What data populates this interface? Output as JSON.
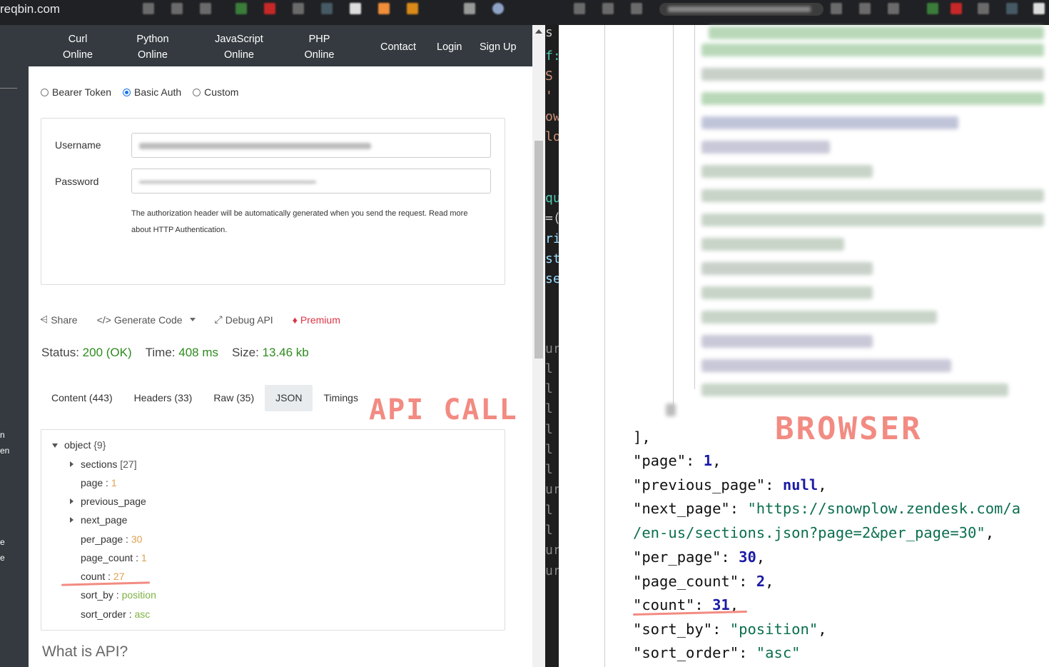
{
  "left_window": {
    "site": "reqbin.com",
    "nav": [
      {
        "line1": "Curl",
        "line2": "Online"
      },
      {
        "line1": "Python",
        "line2": "Online"
      },
      {
        "line1": "JavaScript",
        "line2": "Online"
      },
      {
        "line1": "PHP",
        "line2": "Online"
      },
      {
        "line1": "Contact",
        "line2": ""
      },
      {
        "line1": "Login",
        "line2": ""
      },
      {
        "line1": "Sign Up",
        "line2": ""
      }
    ],
    "sidebar_fragments": [
      "n",
      "en",
      "e",
      "e"
    ],
    "auth_types": [
      "Bearer Token",
      "Basic Auth",
      "Custom"
    ],
    "auth_selected": "Basic Auth",
    "username_label": "Username",
    "password_label": "Password",
    "auth_note": "The authorization header will be automatically generated when you send the request. Read more about HTTP Authentication.",
    "actions": {
      "share": "Share",
      "generate_code": "Generate Code",
      "debug_api": "Debug API",
      "premium": "Premium"
    },
    "status": {
      "status_label": "Status:",
      "status_value": "200 (OK)",
      "time_label": "Time:",
      "time_value": "408 ms",
      "size_label": "Size:",
      "size_value": "13.46 kb"
    },
    "tabs": [
      "Content (443)",
      "Headers (33)",
      "Raw (35)",
      "JSON",
      "Timings"
    ],
    "active_tab": "JSON",
    "overlay_label": "API CALL",
    "json_tree": {
      "root": "object",
      "root_count": "{9}",
      "rows": [
        {
          "key": "sections",
          "meta": "[27]",
          "value": "",
          "type": "expand"
        },
        {
          "key": "page",
          "value": "1",
          "type": "num"
        },
        {
          "key": "previous_page",
          "value": "",
          "type": "expand"
        },
        {
          "key": "next_page",
          "value": "",
          "type": "expand"
        },
        {
          "key": "per_page",
          "value": "30",
          "type": "num"
        },
        {
          "key": "page_count",
          "value": "1",
          "type": "num"
        },
        {
          "key": "count",
          "value": "27",
          "type": "num"
        },
        {
          "key": "sort_by",
          "value": "position",
          "type": "str"
        },
        {
          "key": "sort_order",
          "value": "asc",
          "type": "str"
        }
      ]
    },
    "what_is_api": "What is API?"
  },
  "right_window": {
    "overlay_label": "BROWSER",
    "editor_fragments": [
      "s",
      "f:",
      "S",
      "'",
      "ow",
      "lo",
      "qu",
      "=(",
      "ri",
      "st",
      "se",
      "ur",
      "l",
      "l",
      "l",
      "l",
      "l",
      "l",
      "ur",
      "l",
      "l",
      "ur",
      "ur"
    ],
    "json_lines": [
      {
        "text": "],",
        "parts": [
          {
            "t": "],",
            "c": ""
          }
        ]
      },
      {
        "parts": [
          {
            "t": "\"page\": ",
            "c": ""
          },
          {
            "t": "1",
            "c": "kw"
          },
          {
            "t": ",",
            "c": ""
          }
        ]
      },
      {
        "parts": [
          {
            "t": "\"previous_page\": ",
            "c": ""
          },
          {
            "t": "null",
            "c": "kw"
          },
          {
            "t": ",",
            "c": ""
          }
        ]
      },
      {
        "parts": [
          {
            "t": "\"next_page\": ",
            "c": ""
          },
          {
            "t": "\"https://snowplow.zendesk.com/a",
            "c": "s"
          }
        ]
      },
      {
        "parts": [
          {
            "t": "/en-us/sections.json?page=2&per_page=30\"",
            "c": "s"
          },
          {
            "t": ",",
            "c": ""
          }
        ]
      },
      {
        "parts": [
          {
            "t": "\"per_page\": ",
            "c": ""
          },
          {
            "t": "30",
            "c": "kw"
          },
          {
            "t": ",",
            "c": ""
          }
        ]
      },
      {
        "parts": [
          {
            "t": "\"page_count\": ",
            "c": ""
          },
          {
            "t": "2",
            "c": "kw"
          },
          {
            "t": ",",
            "c": ""
          }
        ]
      },
      {
        "parts": [
          {
            "t": "\"count\": ",
            "c": ""
          },
          {
            "t": "31",
            "c": "kw"
          },
          {
            "t": ",",
            "c": ""
          }
        ]
      },
      {
        "parts": [
          {
            "t": "\"sort_by\": ",
            "c": ""
          },
          {
            "t": "\"position\"",
            "c": "s"
          },
          {
            "t": ",",
            "c": ""
          }
        ]
      },
      {
        "parts": [
          {
            "t": "\"sort_order\": ",
            "c": ""
          },
          {
            "t": "\"asc\"",
            "c": "s"
          }
        ]
      }
    ]
  },
  "colors": {
    "overlay": "#f28b82",
    "status_green": "#2e8b1e",
    "navbar": "#343a40",
    "json_keyword": "#1a1aa6",
    "json_string": "#0b6e4f"
  }
}
